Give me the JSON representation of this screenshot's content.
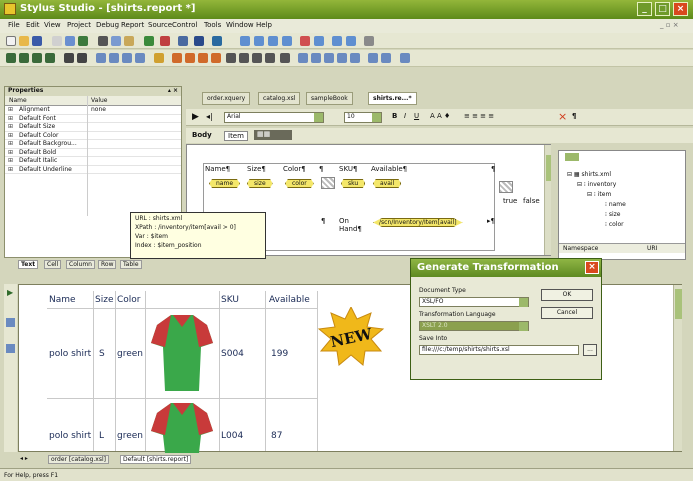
{
  "window": {
    "title": "Stylus Studio - [shirts.report *]"
  },
  "menu": [
    "File",
    "Edit",
    "View",
    "Project",
    "Debug",
    "Report",
    "SourceControl",
    "Tools",
    "Window",
    "Help"
  ],
  "properties": {
    "title": "Properties",
    "col_name": "Name",
    "col_value": "Value",
    "rows": [
      {
        "name": "Alignment",
        "value": "none"
      },
      {
        "name": "Default Font",
        "value": ""
      },
      {
        "name": "Default Size",
        "value": ""
      },
      {
        "name": "Default Color",
        "value": ""
      },
      {
        "name": "Default Backgrou...",
        "value": ""
      },
      {
        "name": "Default Bold",
        "value": ""
      },
      {
        "name": "Default Italic",
        "value": ""
      },
      {
        "name": "Default Underline",
        "value": ""
      }
    ],
    "tabs": [
      "Text",
      "Cell",
      "Column",
      "Row",
      "Table"
    ]
  },
  "doc_tabs": [
    "order.xquery",
    "catalog.xsl",
    "sampleBook",
    "shirts.re...*"
  ],
  "format": {
    "font": "Arial",
    "size": "10",
    "body_label": "Body",
    "item_label": "Item"
  },
  "designer": {
    "headers": [
      "Name¶",
      "Size¶",
      "Color¶",
      "¶",
      "SKU¶",
      "Available¶",
      "¶"
    ],
    "tags": [
      "name",
      "size",
      "color",
      "sku",
      "avail"
    ],
    "on_hand": "On Hand¶",
    "path_tag": "/scn/Inventory/Item[avail]",
    "true_label": "true",
    "false_label": "false"
  },
  "tooltip": {
    "url": "URL  : shirts.xml",
    "xpath": "XPath : /inventory/item[avail > 0]",
    "var": "Var   : $item",
    "index": "Index : $item_position"
  },
  "schema": {
    "nodes": [
      "shirts.xml",
      "inventory",
      "item",
      "name",
      "size",
      "color"
    ],
    "col_namespace": "Namespace",
    "col_uri": "URI"
  },
  "preview": {
    "headers": [
      "Name",
      "Size",
      "Color",
      "SKU",
      "Available"
    ],
    "rows": [
      {
        "name": "polo shirt",
        "size": "S",
        "color": "green",
        "sku": "S004",
        "avail": "199"
      },
      {
        "name": "polo shirt",
        "size": "L",
        "color": "green",
        "sku": "L004",
        "avail": "87"
      }
    ],
    "badge": "NEW"
  },
  "bottom_tabs": [
    "order [catalog.xsl]",
    "Default [shirts.report]"
  ],
  "dialog": {
    "title": "Generate Transformation",
    "doc_type_label": "Document Type",
    "doc_type_value": "XSL/FO",
    "lang_label": "Transformation Language",
    "lang_value": "XSLT 2.0",
    "save_label": "Save Into",
    "save_value": "file:///c:/temp/shirts/shirts.xsl",
    "ok": "OK",
    "cancel": "Cancel",
    "browse": "..."
  },
  "status": "For Help, press F1"
}
